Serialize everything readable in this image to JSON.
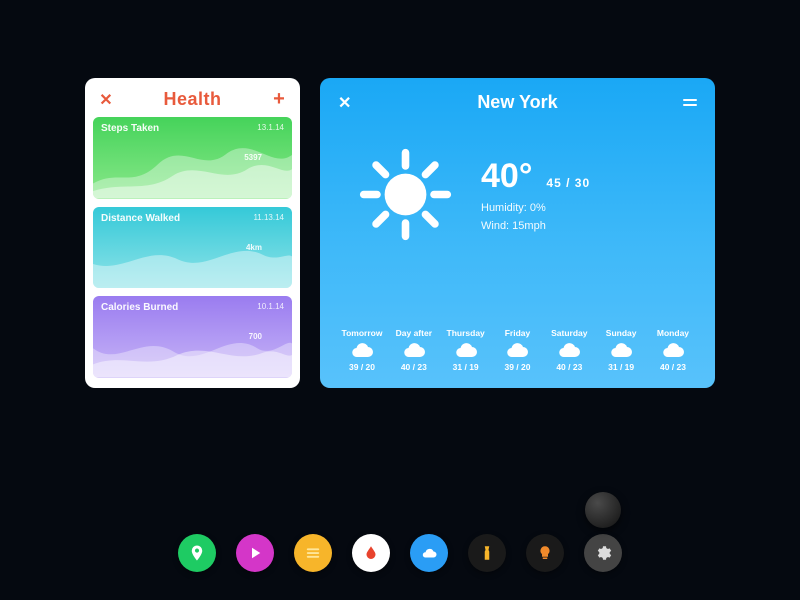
{
  "health": {
    "title": "Health",
    "close_glyph": "✕",
    "add_glyph": "+",
    "metrics": [
      {
        "label": "Steps Taken",
        "date": "13.1.14",
        "value": "5397"
      },
      {
        "label": "Distance Walked",
        "date": "11.13.14",
        "value": "4km"
      },
      {
        "label": "Calories Burned",
        "date": "10.1.14",
        "value": "700"
      }
    ]
  },
  "weather": {
    "city": "New York",
    "close_glyph": "✕",
    "current": {
      "temp": "40°",
      "hilo": "45 / 30",
      "humidity_label": "Humidity: 0%",
      "wind_label": "Wind: 15mph"
    },
    "forecast": [
      {
        "day": "Tomorrow",
        "hilo": "39 / 20"
      },
      {
        "day": "Day after",
        "hilo": "40 / 23"
      },
      {
        "day": "Thursday",
        "hilo": "31 / 19"
      },
      {
        "day": "Friday",
        "hilo": "39 / 20"
      },
      {
        "day": "Saturday",
        "hilo": "40 / 23"
      },
      {
        "day": "Sunday",
        "hilo": "31 / 19"
      },
      {
        "day": "Monday",
        "hilo": "40 / 23"
      }
    ]
  },
  "dock": {
    "items": [
      {
        "name": "location",
        "color": "#1ecb63"
      },
      {
        "name": "play",
        "color": "#d436c8"
      },
      {
        "name": "list",
        "color": "#f7b52a"
      },
      {
        "name": "droplet",
        "color": "#ffffff"
      },
      {
        "name": "cloud",
        "color": "#2a9df5"
      },
      {
        "name": "flashlight",
        "color": "#1a1a1a"
      },
      {
        "name": "bulb",
        "color": "#1a1a1a"
      },
      {
        "name": "settings",
        "color": "#444444"
      }
    ]
  },
  "chart_data": [
    {
      "type": "area",
      "title": "Steps Taken",
      "values": [
        3200,
        2600,
        3400,
        4100,
        5397,
        4800,
        3900
      ]
    },
    {
      "type": "area",
      "title": "Distance Walked",
      "values": [
        2.1,
        2.8,
        3.2,
        4.0,
        3.4,
        2.9,
        3.6
      ]
    },
    {
      "type": "area",
      "title": "Calories Burned",
      "values": [
        520,
        480,
        630,
        700,
        560,
        610,
        650
      ]
    }
  ]
}
